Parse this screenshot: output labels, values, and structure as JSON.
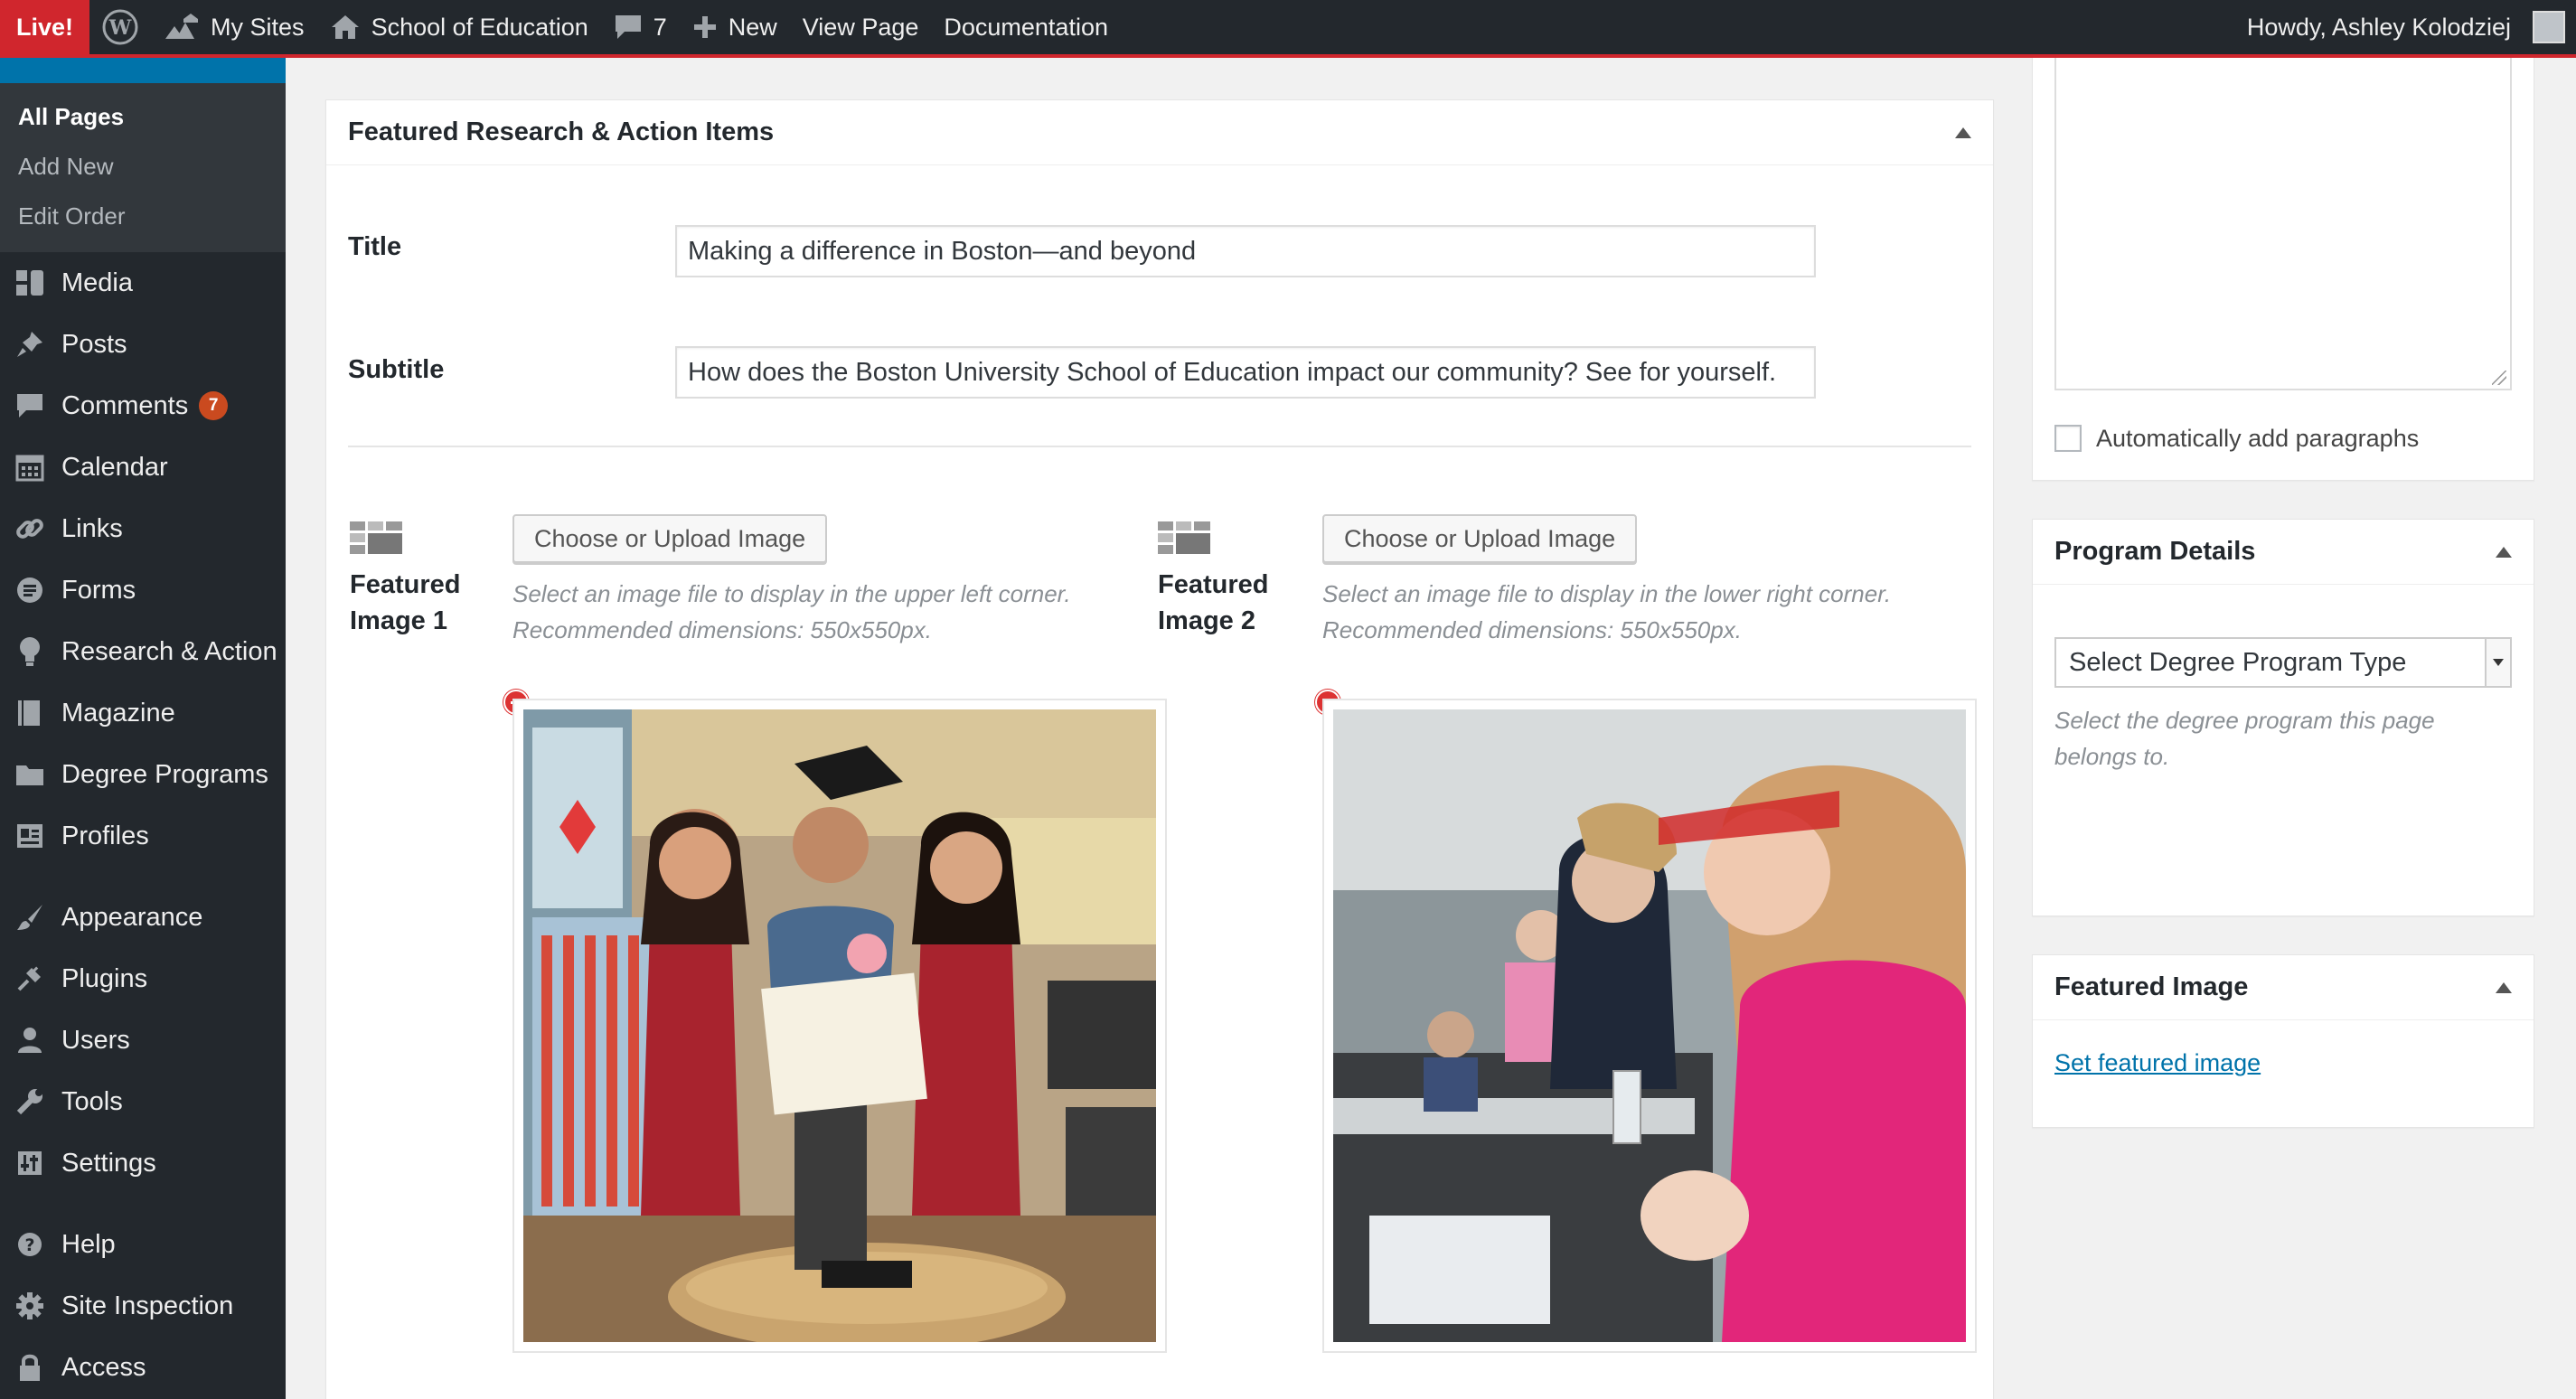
{
  "admin_bar": {
    "live": "Live!",
    "my_sites": "My Sites",
    "site_name": "School of Education",
    "comments_count": "7",
    "new_label": "New",
    "view_page": "View Page",
    "documentation": "Documentation",
    "greeting": "Howdy, Ashley Kolodziej",
    "icons": [
      "wordpress-icon",
      "my-sites-icon",
      "home-icon",
      "comment-icon",
      "plus-icon"
    ]
  },
  "sidebar": {
    "submenu": [
      {
        "label": "All Pages",
        "active": true
      },
      {
        "label": "Add New",
        "active": false
      },
      {
        "label": "Edit Order",
        "active": false
      }
    ],
    "menu": [
      {
        "label": "Media",
        "icon": "media-icon"
      },
      {
        "label": "Posts",
        "icon": "pin-icon"
      },
      {
        "label": "Comments",
        "icon": "comment-icon",
        "badge": "7"
      },
      {
        "label": "Calendar",
        "icon": "calendar-icon"
      },
      {
        "label": "Links",
        "icon": "link-icon"
      },
      {
        "label": "Forms",
        "icon": "forms-icon"
      },
      {
        "label": "Research & Action",
        "icon": "lightbulb-icon"
      },
      {
        "label": "Magazine",
        "icon": "book-icon"
      },
      {
        "label": "Degree Programs",
        "icon": "folder-icon"
      },
      {
        "label": "Profiles",
        "icon": "id-card-icon"
      },
      {
        "label": "Appearance",
        "icon": "brush-icon"
      },
      {
        "label": "Plugins",
        "icon": "plug-icon"
      },
      {
        "label": "Users",
        "icon": "user-icon"
      },
      {
        "label": "Tools",
        "icon": "wrench-icon"
      },
      {
        "label": "Settings",
        "icon": "settings-icon"
      },
      {
        "label": "Help",
        "icon": "help-icon"
      },
      {
        "label": "Site Inspection",
        "icon": "gear-icon"
      },
      {
        "label": "Access",
        "icon": "lock-icon"
      }
    ]
  },
  "featured": {
    "heading": "Featured Research & Action Items",
    "title_label": "Title",
    "title_value": "Making a difference in Boston—and beyond",
    "subtitle_label": "Subtitle",
    "subtitle_value": "How does the Boston University School of Education impact our community? See for yourself.",
    "image1": {
      "label_line1": "Featured",
      "label_line2": "Image 1",
      "button": "Choose or Upload Image",
      "desc_line1": "Select an image file to display in the upper left corner.",
      "desc_line2": "Recommended dimensions: 550x550px."
    },
    "image2": {
      "label_line1": "Featured",
      "label_line2": "Image 2",
      "button": "Choose or Upload Image",
      "desc_line1": "Select an image file to display in the lower right corner.",
      "desc_line2": "Recommended dimensions: 550x550px."
    }
  },
  "right": {
    "auto_paragraphs": "Automatically add paragraphs",
    "program_details": {
      "heading": "Program Details",
      "select_value": "Select Degree Program Type",
      "desc_line1": "Select the degree program this page",
      "desc_line2": "belongs to."
    },
    "featured_image": {
      "heading": "Featured Image",
      "link": "Set featured image"
    }
  },
  "colors": {
    "admin_bar_bg": "#23282d",
    "live_red": "#d0262d",
    "accent_blue": "#0073aa",
    "badge_orange": "#ca4a1f"
  }
}
